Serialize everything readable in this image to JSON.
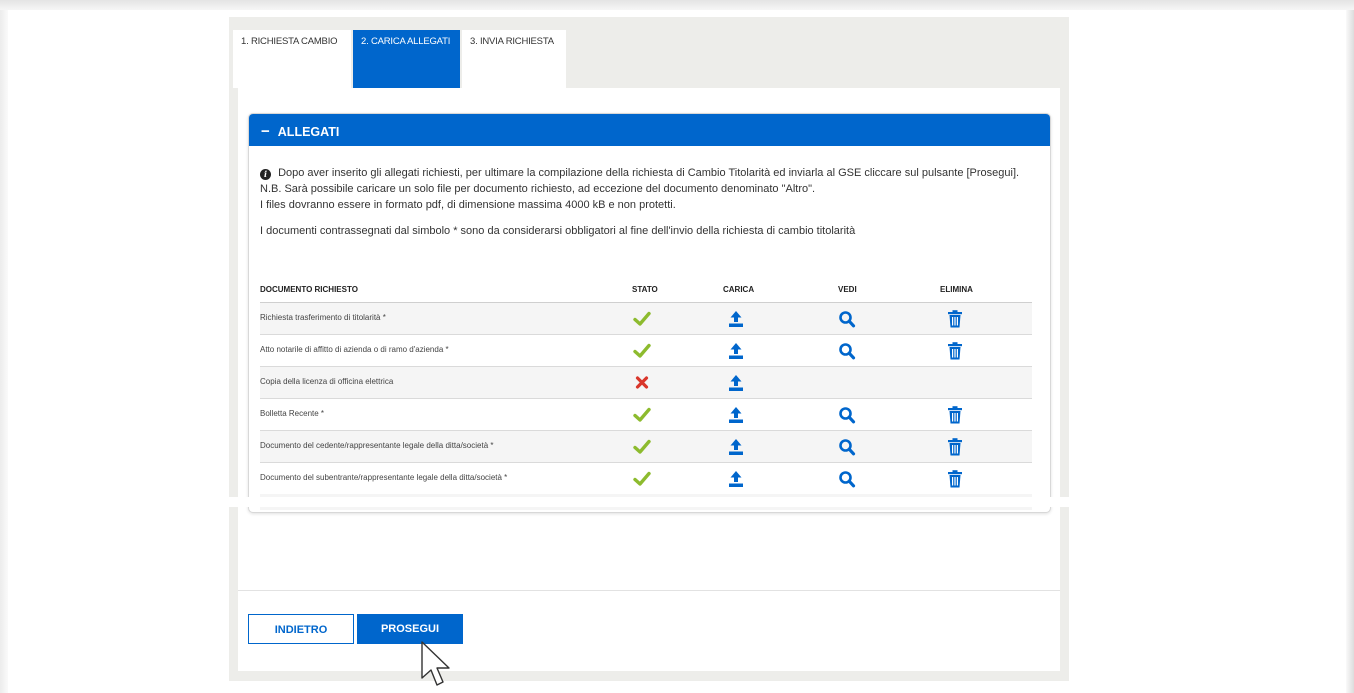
{
  "steps": [
    {
      "label": "1. RICHIESTA CAMBIO"
    },
    {
      "label": "2. CARICA ALLEGATI"
    },
    {
      "label": "3. INVIA RICHIESTA"
    }
  ],
  "active_step": 2,
  "panel": {
    "collapse_symbol": "−",
    "title": "ALLEGATI",
    "info_icon": "info-circle-icon",
    "info_line1": "Dopo aver inserito gli allegati richiesti, per ultimare la compilazione della richiesta di Cambio Titolarità ed inviarla al GSE cliccare sul pulsante [Prosegui].",
    "info_line2": "N.B. Sarà possibile caricare un solo file per documento richiesto, ad eccezione del documento denominato \"Altro\".",
    "info_line3": "I files dovranno essere in formato pdf, di dimensione massima 4000 kB e non protetti.",
    "mandatory_note": "I documenti contrassegnati dal simbolo * sono da considerarsi obbligatori al fine dell'invio della richiesta di cambio titolarità"
  },
  "table": {
    "headers": {
      "doc": "DOCUMENTO RICHIESTO",
      "stato": "STATO",
      "carica": "CARICA",
      "vedi": "VEDI",
      "elimina": "ELIMINA"
    },
    "rows": [
      {
        "doc": "Richiesta trasferimento di titolarità *",
        "status": "ok"
      },
      {
        "doc": "Atto notarile di affitto di azienda o di ramo d'azienda *",
        "status": "ok"
      },
      {
        "doc": "Copia della licenza di officina elettrica",
        "status": "missing"
      },
      {
        "doc": "Bolletta Recente *",
        "status": "ok"
      },
      {
        "doc": "Documento del cedente/rappresentante legale della ditta/società *",
        "status": "ok"
      },
      {
        "doc": "Documento del subentrante/rappresentante legale della ditta/società *",
        "status": "ok"
      }
    ]
  },
  "buttons": {
    "back": "INDIETRO",
    "next": "PROSEGUI"
  },
  "colors": {
    "primary": "#0066cc",
    "ok": "#8dbb2e",
    "error": "#d9362b",
    "background": "#ededea"
  },
  "icons": {
    "ok": "checkmark-icon",
    "missing": "cross-icon",
    "upload": "upload-icon",
    "view": "search-icon",
    "delete": "trash-icon",
    "cursor": "mouse-pointer-icon"
  }
}
